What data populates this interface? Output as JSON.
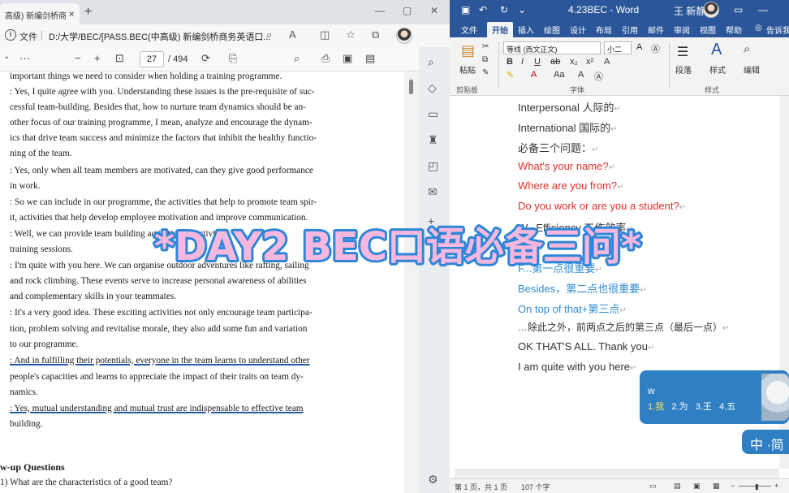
{
  "pdf_browser": {
    "tab_label": "高级) 新编剑桥商",
    "address_label": "文件",
    "address_url": "D:/大学/BEC/[PASS.BEC(中高级) 新编剑桥商务英语口...",
    "page_current": "27",
    "page_total": "/ 494",
    "lines": [
      "important things we need to consider when holding a training programme.",
      ": Yes, I quite agree with you. Understanding these issues is the pre-requisite of suc-",
      "cessful team-building. Besides that, how to nurture team dynamics should be an-",
      "other focus of our training programme, I mean, analyze and encourage the dynam-",
      "ics that drive team success and minimize the factors that inhibit the healthy functio-",
      "ning of the team.",
      ": Yes, only when all team members are motivated, can they give good performance",
      "in work.",
      ": So we can include in our programme, the activities that help to promote team spir-",
      "it, activities that help develop employee motivation and improve communication.",
      ": Well, we can provide team building activities, or activities",
      "training sessions.",
      ": I'm quite with you here. We can organise outdoor adventures like rafting, sailing",
      "and rock climbing. These events serve to increase personal awareness of abilities",
      "and complementary skills in your teammates.",
      ": It's a very good idea. These exciting activities not only encourage team participa-",
      "tion, problem solving and revitalise morale, they also add some fun and variation",
      "to our programme.",
      ": And in fulfilling their potentials, everyone in the team learns to understand other",
      "people's capacities and learns to appreciate the impact of their traits on team dy-",
      "namics.",
      ": Yes, mutual understanding and mutual trust are indispensable to effective team",
      "building."
    ],
    "section_heading": "w-up Questions",
    "question": "1)  What are the characteristics of a good team?"
  },
  "word": {
    "title": "4.23BEC - Word",
    "user_name": "王 新静",
    "tabs": [
      "文件",
      "开始",
      "插入",
      "绘图",
      "设计",
      "布局",
      "引用",
      "邮件",
      "审阅",
      "视图",
      "帮助",
      "告诉我"
    ],
    "active_tab": "开始",
    "font_name": "等线 (西文正文)",
    "font_size": "小二",
    "paste_label": "粘贴",
    "clipboard_group": "剪贴板",
    "font_group": "字体",
    "paragraph_label": "段落",
    "styles_label": "样式",
    "edit_label": "编辑",
    "styles_group": "样式",
    "doc_lines": [
      {
        "text": "Interpersonal  人际的",
        "color": "black"
      },
      {
        "text": "International  国际的",
        "color": "black"
      },
      {
        "text": "必备三个问题：",
        "color": "black"
      },
      {
        "text": "What's your name?",
        "color": "red"
      },
      {
        "text": "Where are you from?",
        "color": "red"
      },
      {
        "text": "Do you work or are you a student?",
        "color": "red"
      },
      {
        "text": "W...Efficiency  工作效率",
        "color": "black"
      },
      {
        "text": "F...第一点很重要",
        "color": "blue"
      },
      {
        "text": "Besides，第二点也很重要",
        "color": "blue"
      },
      {
        "text": "On top of that+第三点",
        "color": "blue"
      },
      {
        "text": "…除此之外，前两点之后的第三点（最后一点）",
        "color": "black"
      },
      {
        "text": "OK THAT'S ALL. Thank you",
        "color": "black"
      },
      {
        "text": "I am quite with you here",
        "color": "black"
      }
    ],
    "status_page": "第 1 页，共 1 页",
    "status_words": "107 个字"
  },
  "ime": {
    "input": "w",
    "candidates": [
      "1.我",
      "2.为",
      "3.王",
      "4.五"
    ],
    "badge": "中 ·简"
  },
  "overlay_title": "*DAY2 BEC口语必备三问*",
  "colors": {
    "word_blue": "#2b579a",
    "overlay_fill": "#f6b8de",
    "overlay_stroke": "#2e86d8",
    "red_text": "#e0302a",
    "blue_text": "#2e8bd6"
  }
}
